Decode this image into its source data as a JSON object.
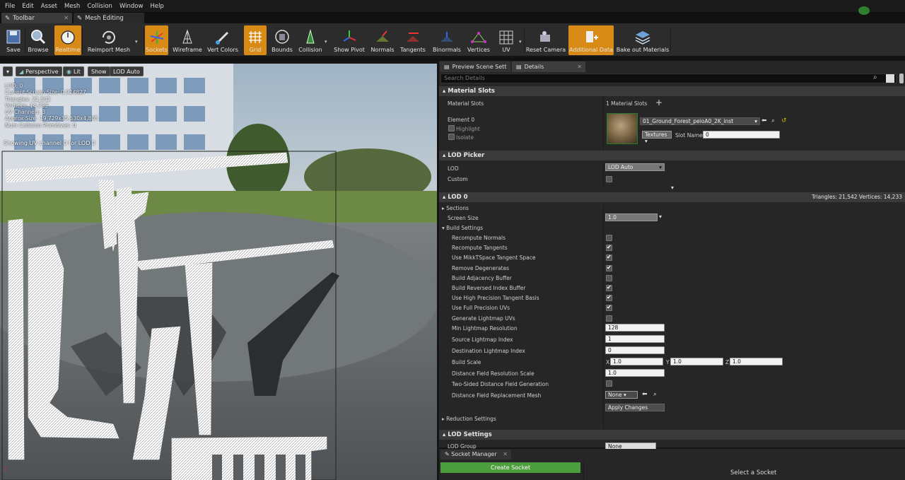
{
  "menu": [
    "File",
    "Edit",
    "Asset",
    "Mesh",
    "Collision",
    "Window",
    "Help"
  ],
  "tabs": {
    "toolbar": "Toolbar",
    "mesh_editing": "Mesh Editing"
  },
  "toolbar": {
    "buttons": [
      {
        "id": "save",
        "label": "Save",
        "icon": "save-icon"
      },
      {
        "id": "browse",
        "label": "Browse",
        "icon": "magnifier-icon"
      },
      {
        "id": "realtime",
        "label": "Realtime",
        "icon": "stopwatch-icon"
      },
      {
        "id": "reimport",
        "label": "Reimport Mesh",
        "icon": "reimport-icon"
      },
      {
        "id": "sockets",
        "label": "Sockets",
        "icon": "sockets-icon"
      },
      {
        "id": "wireframe",
        "label": "Wireframe",
        "icon": "wireframe-icon"
      },
      {
        "id": "vertcolors",
        "label": "Vert Colors",
        "icon": "brush-icon"
      },
      {
        "id": "grid",
        "label": "Grid",
        "icon": "grid-icon"
      },
      {
        "id": "bounds",
        "label": "Bounds",
        "icon": "bounds-icon"
      },
      {
        "id": "collision",
        "label": "Collision",
        "icon": "collision-icon"
      },
      {
        "id": "showpivot",
        "label": "Show Pivot",
        "icon": "pivot-icon"
      },
      {
        "id": "normals",
        "label": "Normals",
        "icon": "normals-icon"
      },
      {
        "id": "tangents",
        "label": "Tangents",
        "icon": "tangents-icon"
      },
      {
        "id": "binormals",
        "label": "Binormals",
        "icon": "binormals-icon"
      },
      {
        "id": "vertices",
        "label": "Vertices",
        "icon": "vertices-icon"
      },
      {
        "id": "uv",
        "label": "UV",
        "icon": "uv-icon"
      },
      {
        "id": "resetcamera",
        "label": "Reset Camera",
        "icon": "camera-icon"
      },
      {
        "id": "additional",
        "label": "Additional Data",
        "icon": "additional-data-icon"
      },
      {
        "id": "bake",
        "label": "Bake out Materials",
        "icon": "layers-icon"
      }
    ]
  },
  "viewport": {
    "perspective": "Perspective",
    "lit": "Lit",
    "show": "Show",
    "lod": "LOD Auto",
    "stats": [
      "LOD:  0",
      "Current Screen Size:  0.914827",
      "Triangles:  21,542",
      "Vertices:  14,233",
      "UV Channels:  3",
      "Approx Size: 19,729x35,530x4,805",
      "Num Collision Primitives:  0"
    ],
    "uv_caption": "Showing UV channel 0 for LOD 0"
  },
  "details": {
    "tabs": [
      "Preview Scene Sett",
      "Details"
    ],
    "search_placeholder": "Search Details",
    "material_slots": {
      "header": "Material Slots",
      "label": "Material Slots",
      "count": "1 Material Slots",
      "element": "Element 0",
      "highlight": "Highlight",
      "isolate": "Isolate",
      "material": "01_Ground_Forest_peioA0_2K_inst",
      "textures": "Textures",
      "slot_name_label": "Slot Name",
      "slot_name": "0"
    },
    "lod_picker": {
      "header": "LOD Picker",
      "lod_label": "LOD",
      "lod_value": "LOD Auto",
      "custom": "Custom"
    },
    "lod0": {
      "header": "LOD 0",
      "summary": "Triangles: 21,542   Vertices: 14,233",
      "sections": "Sections",
      "screen_size_label": "Screen Size",
      "screen_size": "1.0",
      "build_settings": "Build Settings",
      "checks": [
        {
          "label": "Recompute Normals",
          "checked": false
        },
        {
          "label": "Recompute Tangents",
          "checked": true
        },
        {
          "label": "Use MikkTSpace Tangent Space",
          "checked": true
        },
        {
          "label": "Remove Degenerates",
          "checked": true
        },
        {
          "label": "Build Adjacency Buffer",
          "checked": false
        },
        {
          "label": "Build Reversed Index Buffer",
          "checked": true
        },
        {
          "label": "Use High Precision Tangent Basis",
          "checked": true
        },
        {
          "label": "Use Full Precision UVs",
          "checked": true
        },
        {
          "label": "Generate Lightmap UVs",
          "checked": false
        }
      ],
      "min_lightmap_label": "Min Lightmap Resolution",
      "min_lightmap": "128",
      "src_lightmap_label": "Source Lightmap Index",
      "src_lightmap": "1",
      "dst_lightmap_label": "Destination Lightmap Index",
      "dst_lightmap": "0",
      "build_scale_label": "Build Scale",
      "scale_x": "1.0",
      "scale_y": "1.0",
      "scale_z": "1.0",
      "df_res_label": "Distance Field Resolution Scale",
      "df_res": "1.0",
      "two_sided_label": "Two-Sided Distance Field Generation",
      "df_mesh_label": "Distance Field Replacement Mesh",
      "df_mesh": "None",
      "apply": "Apply Changes",
      "reduction": "Reduction Settings"
    },
    "lod_settings": {
      "header": "LOD Settings",
      "lod_group": "LOD Group",
      "lod_group_value": "None"
    }
  },
  "socket_manager": {
    "tab": "Socket Manager",
    "create": "Create Socket",
    "select": "Select a Socket"
  }
}
